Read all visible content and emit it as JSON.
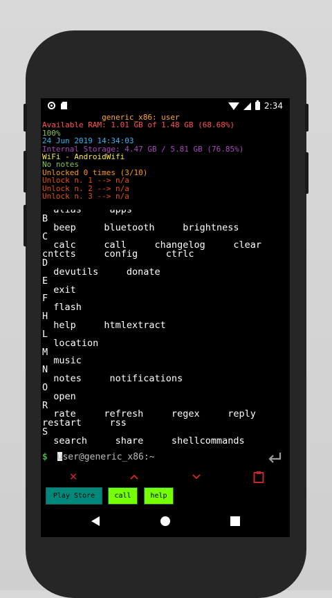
{
  "status": {
    "time": "2:34"
  },
  "info_lines": [
    {
      "text": "             generic_x86: user",
      "color": "#ffa726"
    },
    {
      "text": "Available RAM: 1.01 GB of 1.48 GB (68.68%)",
      "color": "#ff5252"
    },
    {
      "text": "100%",
      "color": "#8bc34a"
    },
    {
      "text": "24 Jun 2019 14:34:03",
      "color": "#29b6f6"
    },
    {
      "text": "Internal Storage: 4.47 GB / 5.81 GB (76.85%)",
      "color": "#ab47bc"
    },
    {
      "text": "WiFi - AndroidWifi",
      "color": "#ffeb3b"
    },
    {
      "text": "No notes",
      "color": "#8bc34a"
    },
    {
      "text": "Unlocked 0 times (3/10)",
      "color": "#ff9800"
    },
    {
      "text": "Unlock n. 1 --> n/a",
      "color": "#e65100"
    },
    {
      "text": "Unlock n. 2 --> n/a",
      "color": "#e65100"
    },
    {
      "text": "Unlock n. 3 --> n/a",
      "color": "#e65100"
    }
  ],
  "command_rows": [
    "  alias     apps",
    "B",
    "  beep     bluetooth     brightness",
    "C",
    "  calc     call     changelog     clear",
    "cntcts     config     ctrlc",
    "D",
    "  devutils     donate",
    "E",
    "  exit",
    "F",
    "  flash",
    "H",
    "  help     htmlextract",
    "L",
    "  location",
    "M",
    "  music",
    "N",
    "  notes     notifications",
    "O",
    "  open",
    "R",
    "  rate     refresh     regex     reply",
    "restart     rss",
    "S",
    "  search     share     shellcommands"
  ],
  "prompt": {
    "symbol": "$",
    "text": "user@generic_x86:~"
  },
  "buttons": {
    "play_store": "Play Store",
    "call": "call",
    "help": "help"
  },
  "icons": {
    "close": "close-icon",
    "up": "chevron-up-icon",
    "down": "chevron-down-icon",
    "paste": "clipboard-icon",
    "enter": "enter-icon"
  },
  "colors": {
    "accent_red": "#c62828",
    "play_store_bg": "#00897b",
    "button_bg": "#76ff03"
  }
}
